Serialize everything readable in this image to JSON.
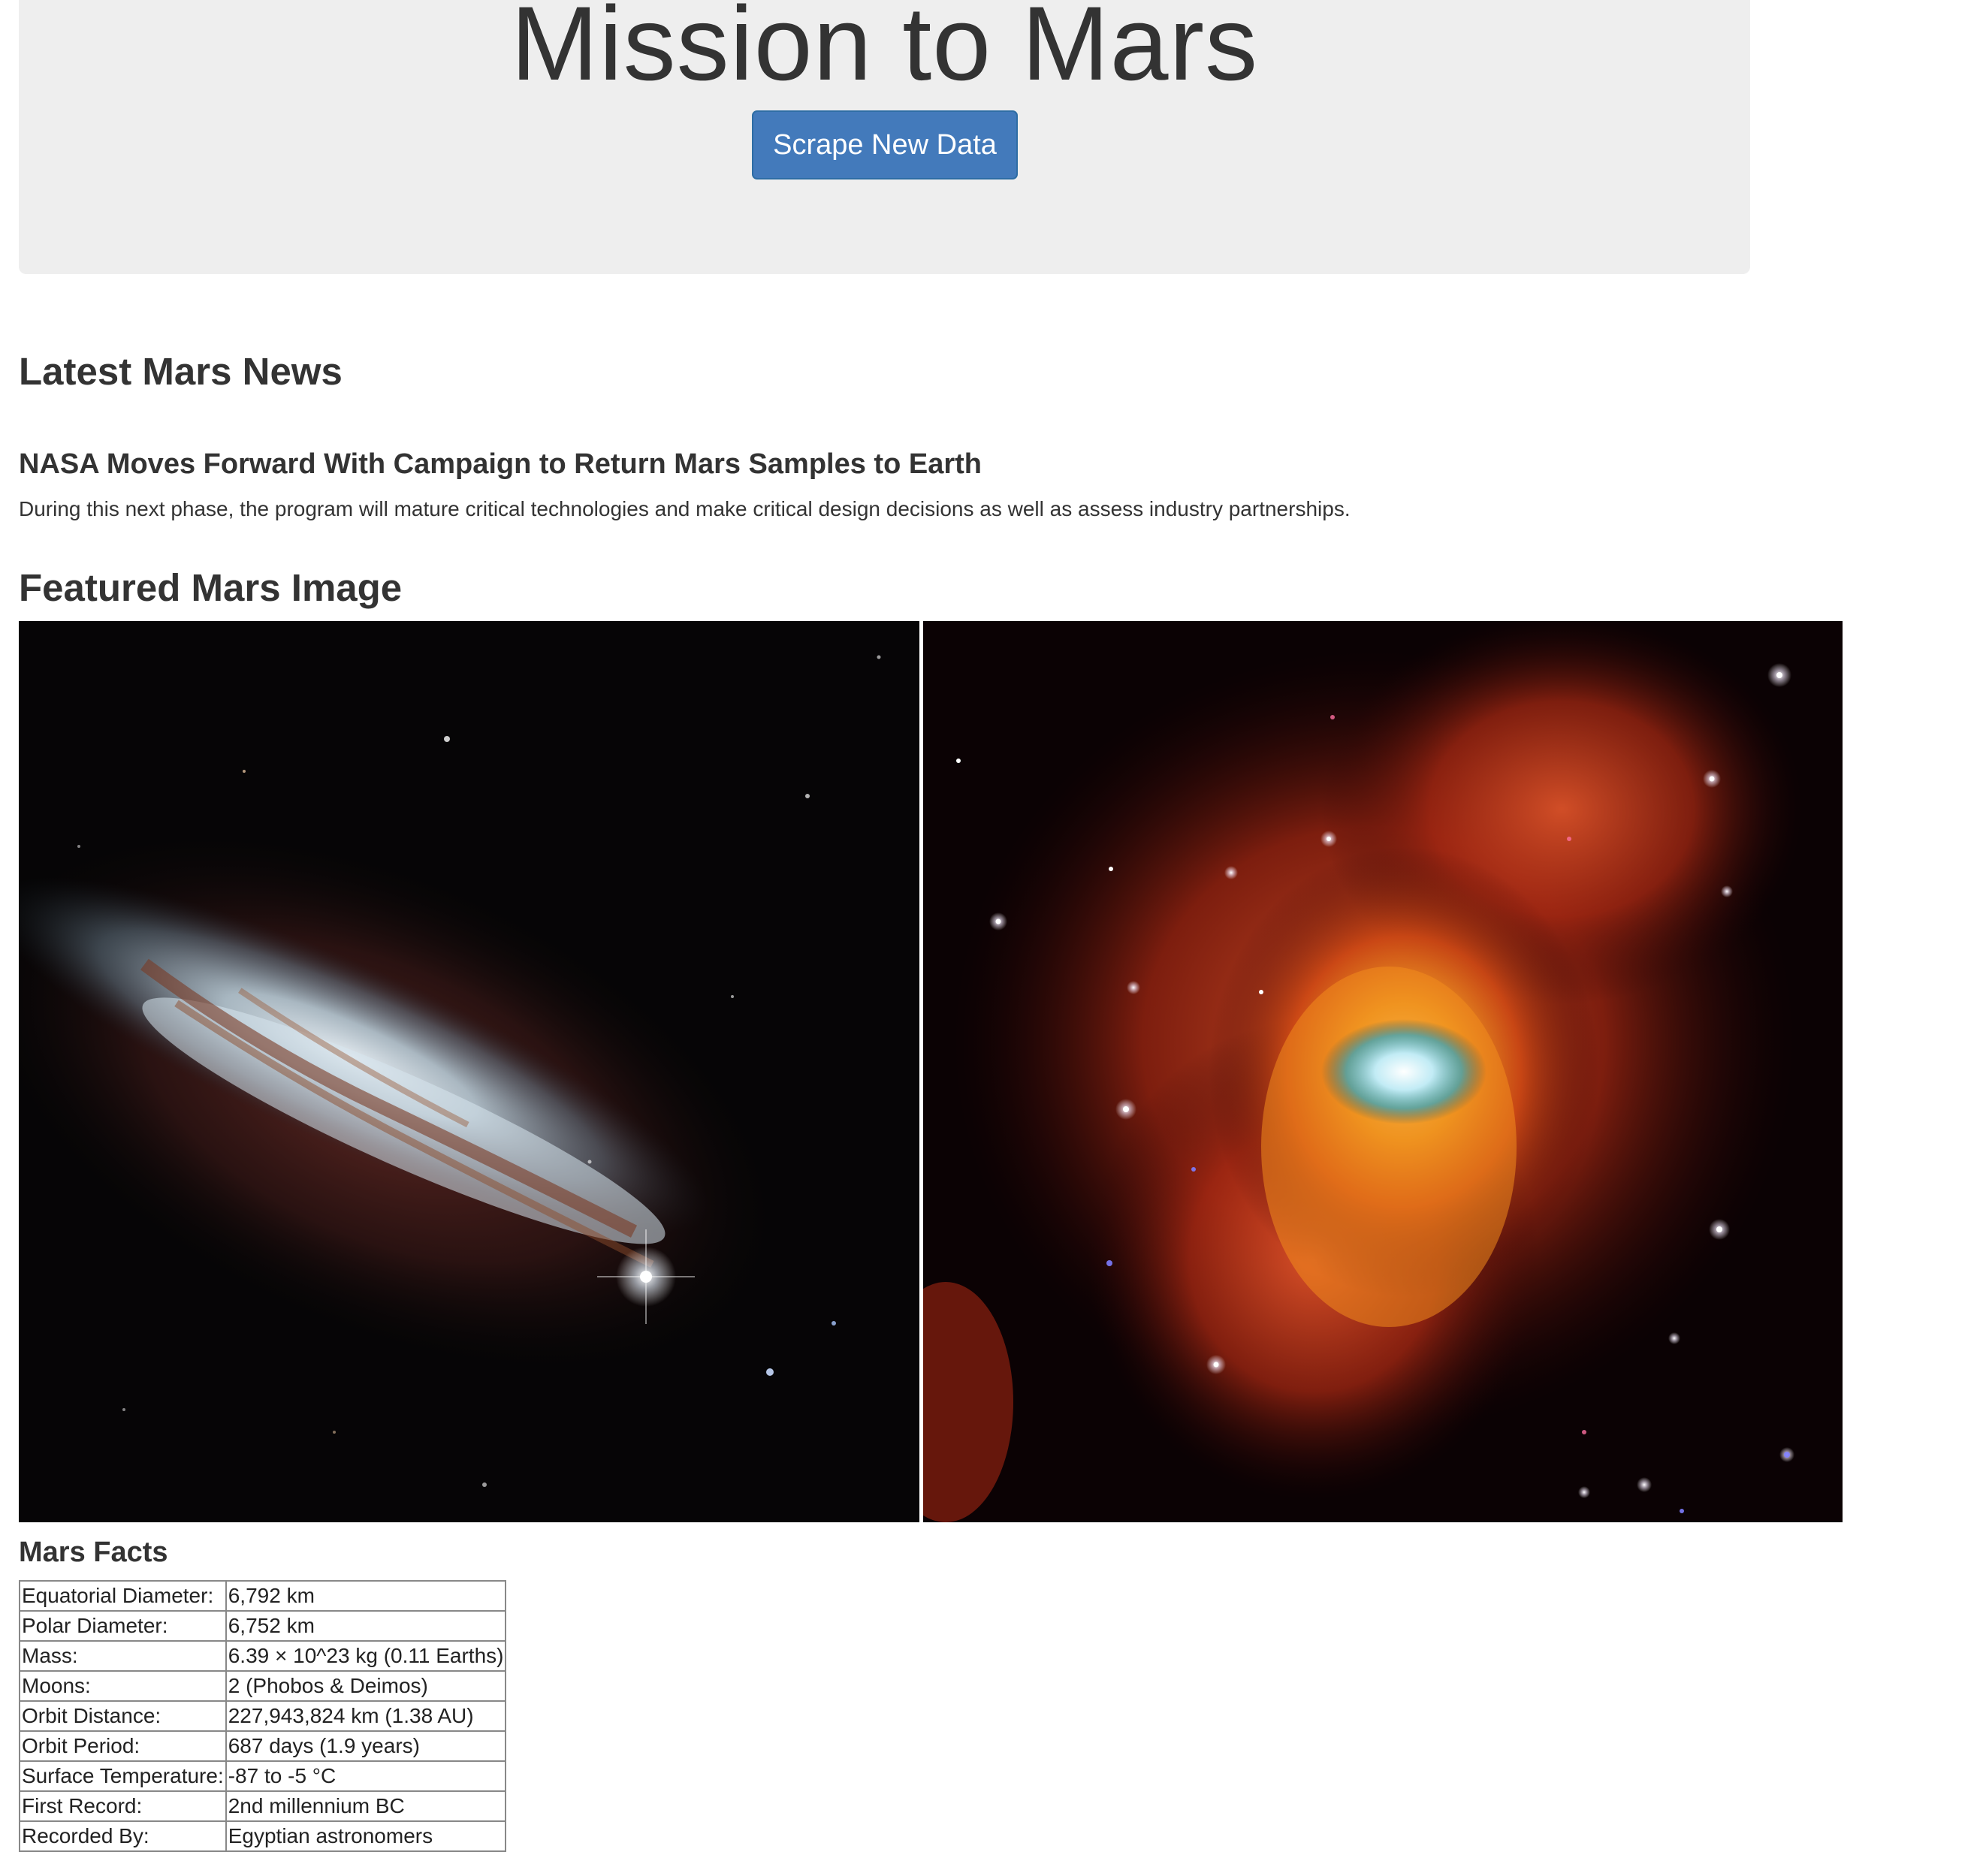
{
  "header": {
    "title": "Mission to Mars",
    "scrape_button_label": "Scrape New Data"
  },
  "news": {
    "section_title": "Latest Mars News",
    "headline": "NASA Moves Forward With Campaign to Return Mars Samples to Earth",
    "teaser": "During this next phase, the program will mature critical technologies and make critical design decisions as well as assess industry partnerships."
  },
  "featured_image": {
    "section_title": "Featured Mars Image"
  },
  "facts": {
    "section_title": "Mars Facts",
    "rows": [
      {
        "label": "Equatorial Diameter:",
        "value": "6,792 km"
      },
      {
        "label": "Polar Diameter:",
        "value": "6,752 km"
      },
      {
        "label": "Mass:",
        "value": "6.39 × 10^23 kg (0.11 Earths)"
      },
      {
        "label": "Moons:",
        "value": "2 (Phobos & Deimos)"
      },
      {
        "label": "Orbit Distance:",
        "value": "227,943,824 km (1.38 AU)"
      },
      {
        "label": "Orbit Period:",
        "value": "687 days (1.9 years)"
      },
      {
        "label": "Surface Temperature:",
        "value": "-87 to -5 °C"
      },
      {
        "label": "First Record:",
        "value": "2nd millennium BC"
      },
      {
        "label": "Recorded By:",
        "value": "Egyptian astronomers"
      }
    ]
  },
  "colors": {
    "jumbotron_bg": "#eeeeee",
    "button_bg": "#437abb",
    "button_border": "#2e6da4",
    "text": "#333333"
  }
}
